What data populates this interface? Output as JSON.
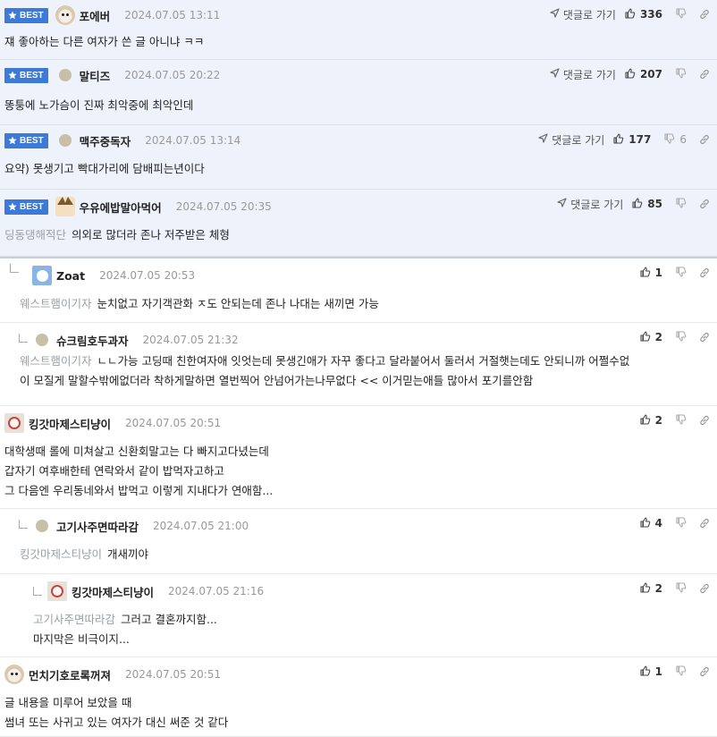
{
  "ui": {
    "best_label": "BEST",
    "reply_label": "댓글로 가기"
  },
  "comments": [
    {
      "nick": "포에버",
      "date": "2024.07.05 13:11",
      "likes": "336",
      "dislikes": "",
      "lines": [
        "쟤 좋아하는 다른 여자가 쓴 글 아니냐 ㅋㅋ"
      ],
      "mention": ""
    },
    {
      "nick": "말티즈",
      "date": "2024.07.05 20:22",
      "likes": "207",
      "dislikes": "",
      "lines": [
        "똥퉁에 노가슴이 진짜 최악중에 최악인데"
      ],
      "mention": ""
    },
    {
      "nick": "맥주중독자",
      "date": "2024.07.05 13:14",
      "likes": "177",
      "dislikes": "6",
      "lines": [
        "요약) 못생기고 빡대가리에 담배피는년이다"
      ],
      "mention": ""
    },
    {
      "nick": "우유에밥말아먹어",
      "date": "2024.07.05 20:35",
      "likes": "85",
      "dislikes": "",
      "lines": [
        "의외로 많더라 존나 저주받은 체형"
      ],
      "mention": "딩동댕해적단"
    },
    {
      "nick": "Zoat",
      "date": "2024.07.05 20:53",
      "likes": "1",
      "dislikes": "",
      "lines": [
        "눈치없고 자기객관화 ㅈ도 안되는데 존나 나대는 새끼면 가능"
      ],
      "mention": "웨스트햄이기자"
    },
    {
      "nick": "슈크림호두과자",
      "date": "2024.07.05 21:32",
      "likes": "2",
      "dislikes": "",
      "lines": [
        "ㄴㄴ가능 고딩때 친한여자애 잇엇는데 못생긴애가 자꾸 좋다고 달라붙어서 둘러서 거절햇는데도 안되니까 어쩔수없",
        "이 모질게 말할수밖에없더라 착하게말하면 열번찍어 안넘어가는나무없다 << 이거믿는애들 많아서 포기를안함"
      ],
      "mention": "웨스트햄이기자"
    },
    {
      "nick": "킹갓마제스티냥이",
      "date": "2024.07.05 20:51",
      "likes": "2",
      "dislikes": "",
      "lines": [
        "대학생때 롤에 미쳐살고 신환회말고는 다 빠지고다녔는데",
        "갑자기 여후배한테 연락와서 같이 밥먹자고하고",
        "그 다음엔 우리동네와서 밥먹고 이렇게 지내다가 연애함..."
      ],
      "mention": ""
    },
    {
      "nick": "고기사주면따라감",
      "date": "2024.07.05 21:00",
      "likes": "4",
      "dislikes": "",
      "lines": [
        "개새끼야"
      ],
      "mention": "킹갓마제스티냥이"
    },
    {
      "nick": "킹갓마제스티냥이",
      "date": "2024.07.05 21:16",
      "likes": "2",
      "dislikes": "",
      "lines": [
        "그러고 결혼까지함...",
        "마지막은 비극이지..."
      ],
      "mention": "고기사주면따라감"
    },
    {
      "nick": "먼치기호로록꺼져",
      "date": "2024.07.05 20:51",
      "likes": "1",
      "dislikes": "",
      "lines": [
        "글 내용을 미루어 보았을 때",
        "썸녀 또는 사귀고 있는 여자가 대신 써준 것 같다"
      ],
      "mention": ""
    }
  ],
  "colors": {
    "accent": "#3d79d6",
    "best_bg": "#eef3fb",
    "muted": "#9aa0a6"
  }
}
